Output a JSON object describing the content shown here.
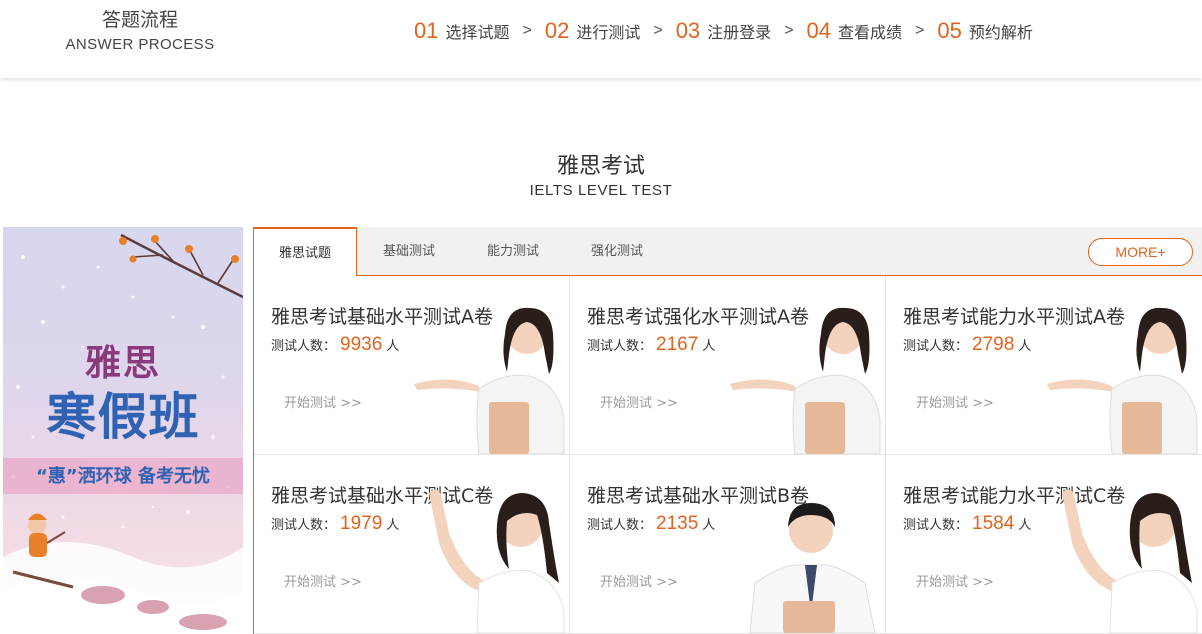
{
  "process": {
    "title_cn": "答题流程",
    "title_en": "ANSWER PROCESS",
    "steps": [
      {
        "num": "01",
        "label": "选择试题"
      },
      {
        "num": "02",
        "label": "进行测试"
      },
      {
        "num": "03",
        "label": "注册登录"
      },
      {
        "num": "04",
        "label": "查看成绩"
      },
      {
        "num": "05",
        "label": "预约解析"
      }
    ],
    "separator": ">"
  },
  "section": {
    "title_cn": "雅思考试",
    "title_en": "IELTS LEVEL TEST"
  },
  "banner": {
    "line1": "雅思",
    "line2": "寒假班",
    "line3": "“惠”洒环球  备考无忧"
  },
  "tabs": {
    "items": [
      {
        "label": "雅思试题",
        "active": true
      },
      {
        "label": "基础测试",
        "active": false
      },
      {
        "label": "能力测试",
        "active": false
      },
      {
        "label": "强化测试",
        "active": false
      }
    ],
    "more": "MORE+"
  },
  "cards": [
    {
      "title": "雅思考试基础水平测试A卷",
      "count_label": "测试人数：",
      "count": "9936",
      "unit": "人",
      "start": "开始测试 >>",
      "image": "woman-holding-book"
    },
    {
      "title": "雅思考试强化水平测试A卷",
      "count_label": "测试人数：",
      "count": "2167",
      "unit": "人",
      "start": "开始测试 >>",
      "image": "woman-holding-book"
    },
    {
      "title": "雅思考试能力水平测试A卷",
      "count_label": "测试人数：",
      "count": "2798",
      "unit": "人",
      "start": "开始测试 >>",
      "image": "woman-holding-book"
    },
    {
      "title": "雅思考试基础水平测试C卷",
      "count_label": "测试人数：",
      "count": "1979",
      "unit": "人",
      "start": "开始测试 >>",
      "image": "woman-pointing"
    },
    {
      "title": "雅思考试基础水平测试B卷",
      "count_label": "测试人数：",
      "count": "2135",
      "unit": "人",
      "start": "开始测试 >>",
      "image": "man-holding-book"
    },
    {
      "title": "雅思考试能力水平测试C卷",
      "count_label": "测试人数：",
      "count": "1584",
      "unit": "人",
      "start": "开始测试 >>",
      "image": "woman-pointing"
    }
  ],
  "colors": {
    "accent": "#e5621d",
    "banner_blue": "#2f62b2",
    "banner_purple": "#8a3a7a"
  }
}
